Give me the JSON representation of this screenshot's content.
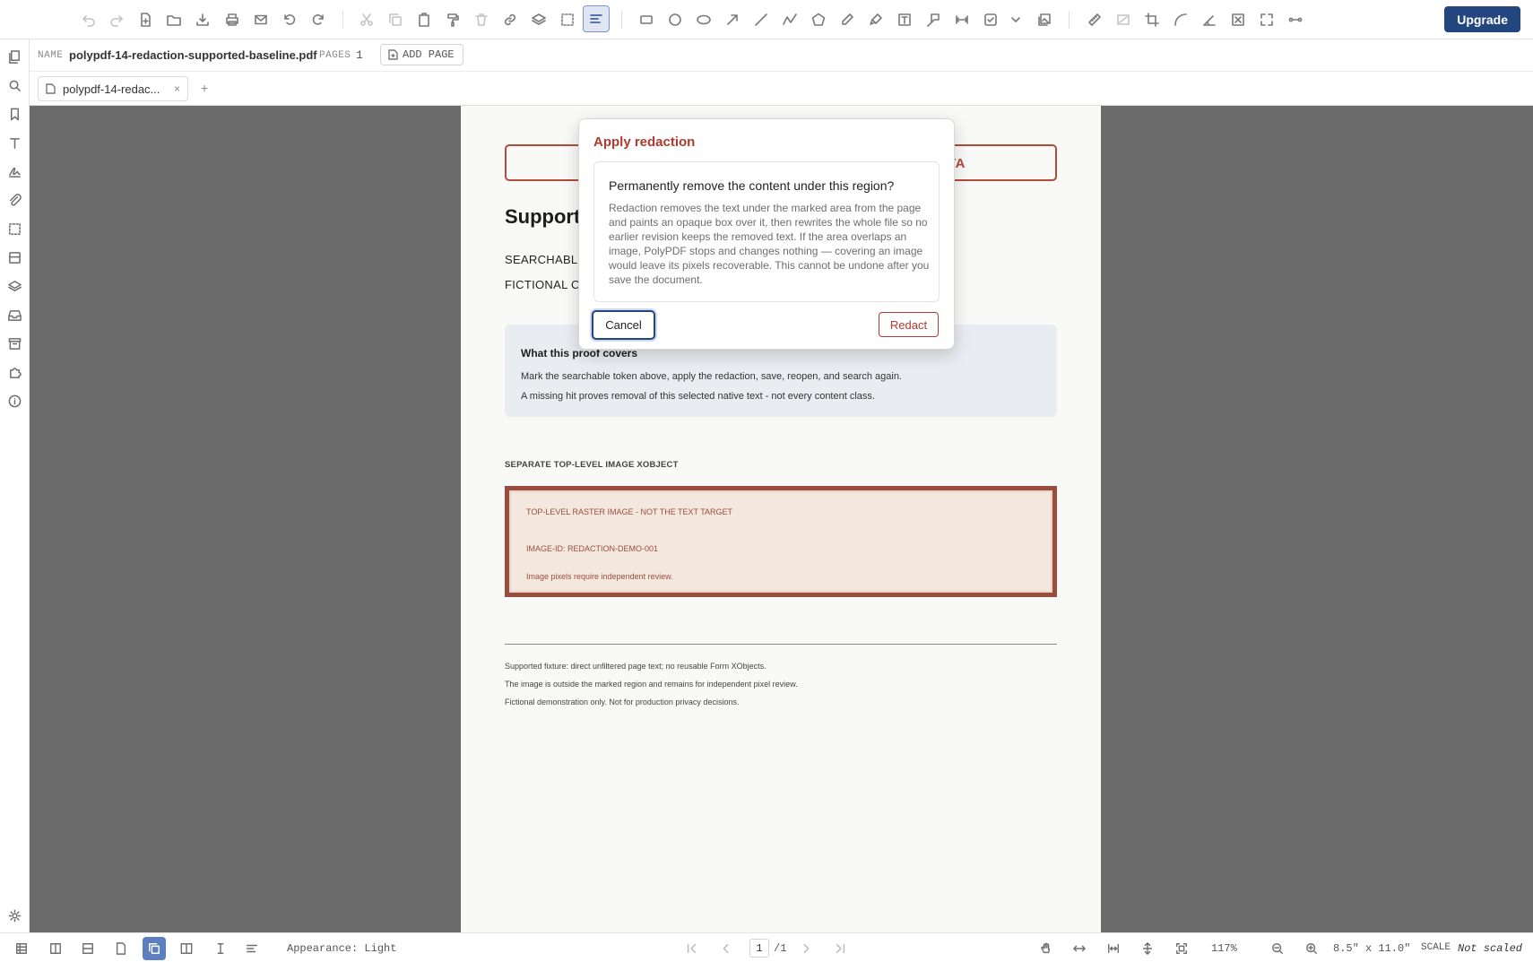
{
  "toolbar": {
    "upgrade_label": "Upgrade",
    "icons": [
      "undo-icon",
      "redo-icon",
      "new-file-icon",
      "open-folder-icon",
      "download-icon",
      "print-icon",
      "mail-icon",
      "rotate-left-icon",
      "rotate-right-icon",
      "cut-icon",
      "copy-icon",
      "paste-icon",
      "format-painter-icon",
      "delete-icon",
      "link-icon",
      "layers-icon",
      "select-area-icon",
      "align-icon",
      "rectangle-icon",
      "circle-icon",
      "ellipse-icon",
      "arrow-icon",
      "line-icon",
      "polyline-icon",
      "polygon-icon",
      "pen-icon",
      "highlighter-icon",
      "text-box-icon",
      "callout-icon",
      "dimension-icon",
      "checkbox-icon",
      "chevron-down-icon",
      "image-icon",
      "measure-icon",
      "redact-area-icon",
      "crop-icon",
      "curve-icon",
      "angle-icon",
      "clear-icon",
      "fullscreen-icon",
      "connector-icon"
    ]
  },
  "doc_info": {
    "name_label": "NAME",
    "name_value": "polypdf-14-redaction-supported-baseline.pdf",
    "pages_label": "PAGES",
    "pages_value": "1",
    "add_page_label": "ADD PAGE"
  },
  "tabs": [
    {
      "label": "polypdf-14-redac...",
      "close": "×"
    }
  ],
  "tab_add": "+",
  "page": {
    "banner_text": "TA",
    "title": "Support",
    "line1": "SEARCHABLE",
    "line2": "FICTIONAL C",
    "proof": {
      "title": "What this proof covers",
      "line1": "Mark the searchable token above, apply the redaction, save, reopen, and search again.",
      "line2": "A missing hit proves removal of this selected native text - not every content class."
    },
    "image_section_heading": "SEPARATE TOP-LEVEL IMAGE XOBJECT",
    "image": {
      "line1": "TOP-LEVEL RASTER IMAGE - NOT THE TEXT TARGET",
      "line2": "IMAGE-ID: REDACTION-DEMO-001",
      "line3": "Image pixels require independent review."
    },
    "footer": {
      "line1": "Supported fixture: direct unfiltered page text; no reusable Form XObjects.",
      "line2": "The image is outside the marked region and remains for independent pixel review.",
      "line3": "Fictional demonstration only. Not for production privacy decisions."
    }
  },
  "modal": {
    "title": "Apply redaction",
    "question": "Permanently remove the content under this region?",
    "description": "Redaction removes the text under the marked area from the page and paints an opaque box over it, then rewrites the whole file so no earlier revision keeps the removed text. If the area overlaps an image, PolyPDF stops and changes nothing — covering an image would leave its pixels recoverable. This cannot be undone after you save the document.",
    "cancel_label": "Cancel",
    "redact_label": "Redact"
  },
  "statusbar": {
    "appearance": "Appearance: Light",
    "page_current": "1",
    "page_total": "/1",
    "zoom": "117%",
    "page_size": "8.5\" x 11.0\"",
    "scale_label": "SCALE",
    "scale_value": "Not scaled"
  },
  "colors": {
    "accent": "#24467f",
    "danger": "#b03a2e",
    "canvas": "#6b6b6b"
  }
}
